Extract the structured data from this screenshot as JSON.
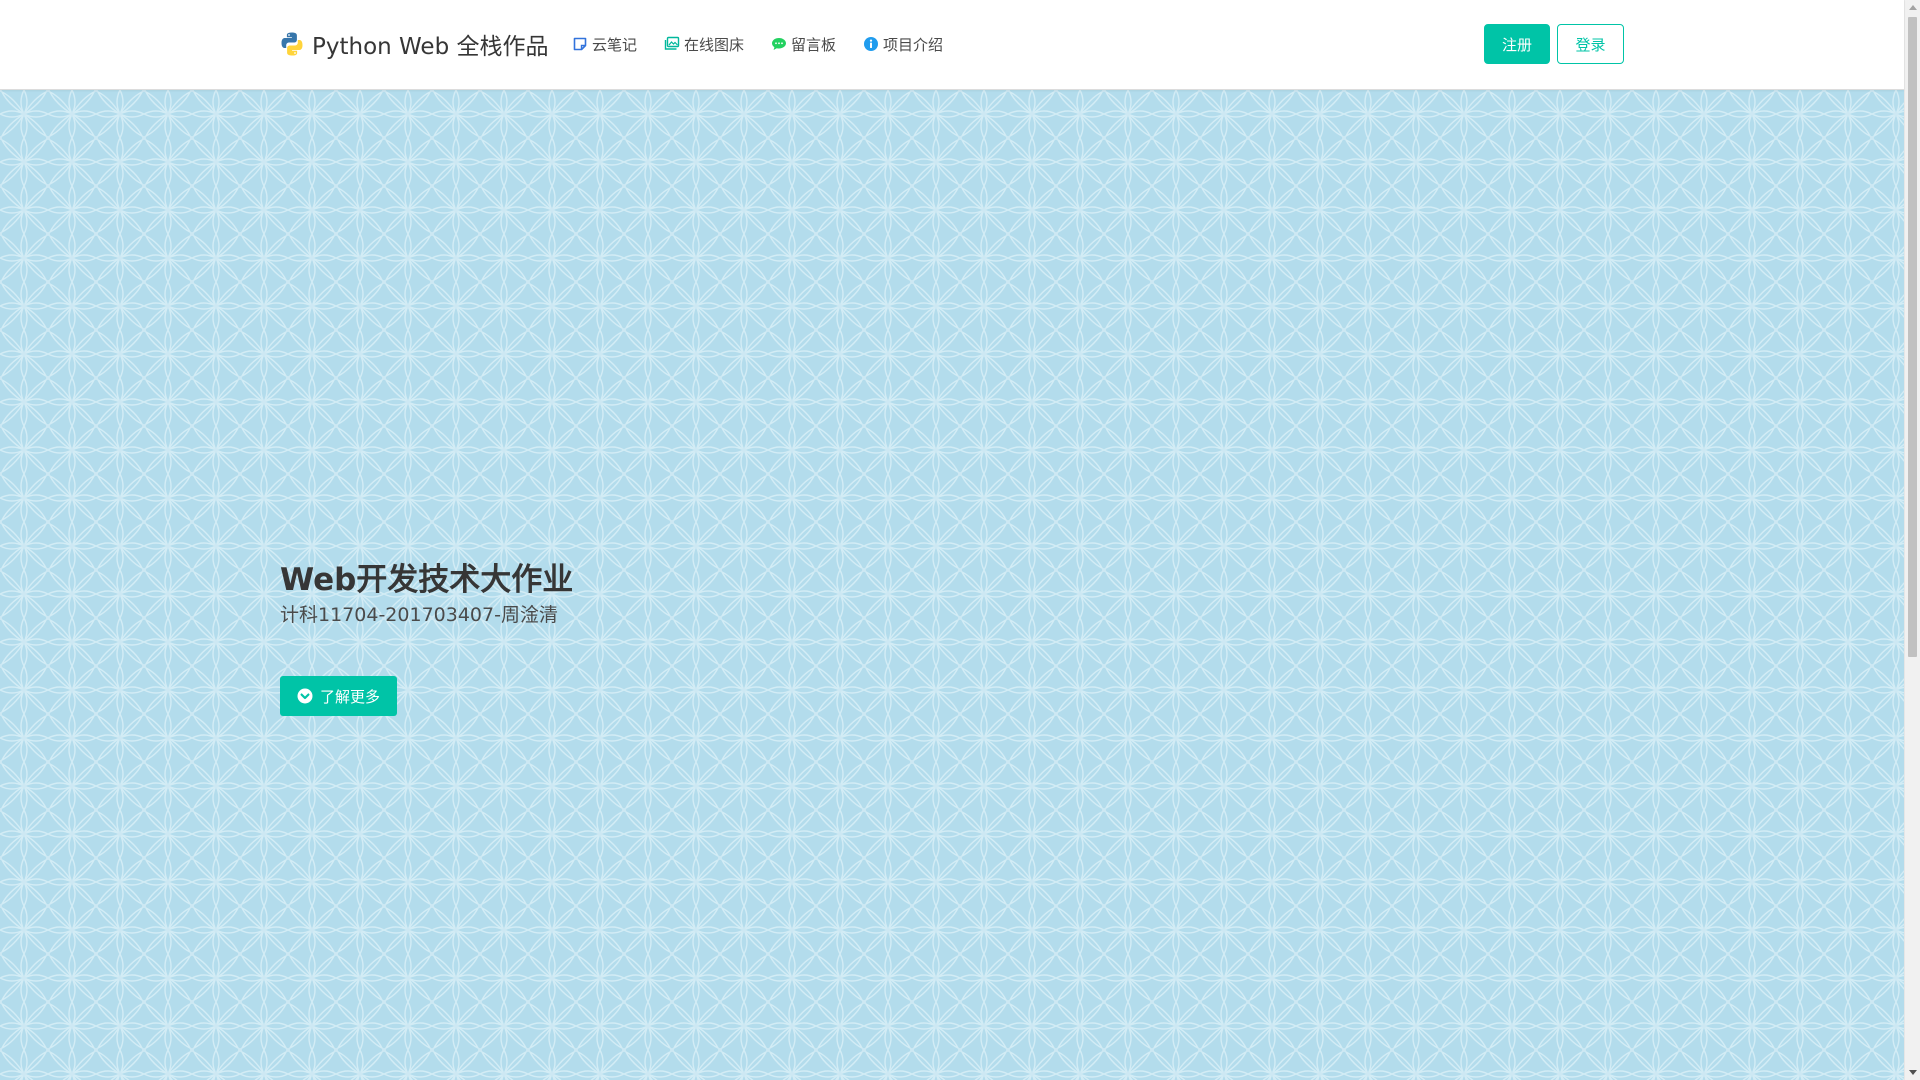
{
  "navbar": {
    "brand_title": "Python Web 全栈作品",
    "links": [
      {
        "label": "云笔记",
        "icon": "note-icon"
      },
      {
        "label": "在线图床",
        "icon": "images-icon"
      },
      {
        "label": "留言板",
        "icon": "comments-icon"
      },
      {
        "label": "项目介绍",
        "icon": "info-icon"
      }
    ],
    "register_label": "注册",
    "login_label": "登录"
  },
  "hero": {
    "title": "Web开发技术大作业",
    "subtitle": "计科11704-201703407-周淦清",
    "more_label": "了解更多"
  },
  "colors": {
    "accent": "#00c4a7",
    "hero_background": "#b3dcec",
    "text_dark": "#363636"
  }
}
